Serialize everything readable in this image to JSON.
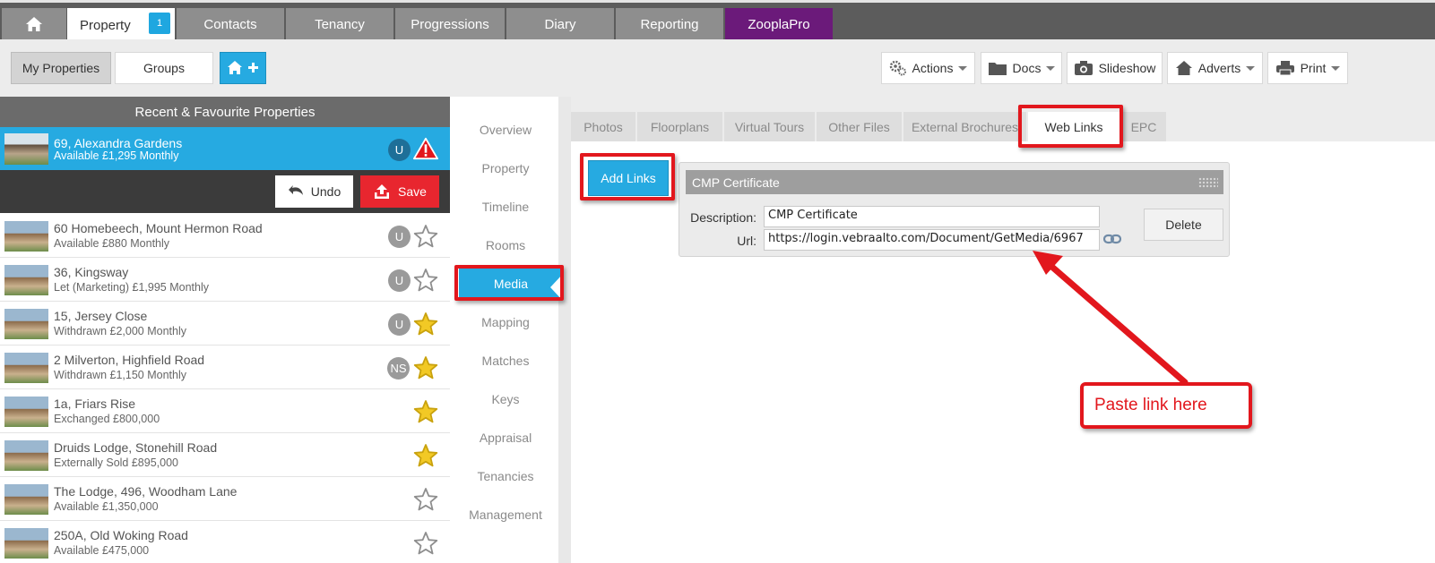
{
  "nav": {
    "tabs": [
      {
        "label": "Property",
        "badge": "1"
      },
      {
        "label": "Contacts"
      },
      {
        "label": "Tenancy"
      },
      {
        "label": "Progressions"
      },
      {
        "label": "Diary"
      },
      {
        "label": "Reporting"
      },
      {
        "label": "ZooplaPro"
      }
    ]
  },
  "toolbar": {
    "my_properties": "My Properties",
    "groups": "Groups",
    "actions": "Actions",
    "docs": "Docs",
    "slideshow": "Slideshow",
    "adverts": "Adverts",
    "print": "Print"
  },
  "recent": {
    "header": "Recent & Favourite Properties",
    "selected": {
      "address": "69, Alexandra Gardens",
      "status": "Available £1,295 Monthly",
      "badge": "U"
    },
    "undo": "Undo",
    "save": "Save",
    "items": [
      {
        "address": "60 Homebeech, Mount Hermon Road",
        "status": "Available £880 Monthly",
        "badge": "U",
        "favourite": false
      },
      {
        "address": "36, Kingsway",
        "status": "Let (Marketing) £1,995 Monthly",
        "badge": "U",
        "favourite": false
      },
      {
        "address": "15, Jersey Close",
        "status": "Withdrawn £2,000 Monthly",
        "badge": "U",
        "favourite": true
      },
      {
        "address": "2 Milverton, Highfield Road",
        "status": "Withdrawn £1,150 Monthly",
        "badge": "NS",
        "favourite": true
      },
      {
        "address": "1a, Friars Rise",
        "status": "Exchanged £800,000",
        "badge": "",
        "favourite": true
      },
      {
        "address": "Druids Lodge, Stonehill Road",
        "status": "Externally Sold £895,000",
        "badge": "",
        "favourite": true
      },
      {
        "address": "The Lodge, 496, Woodham Lane",
        "status": "Available £1,350,000",
        "badge": "",
        "favourite": false
      },
      {
        "address": "250A, Old Woking Road",
        "status": "Available £475,000",
        "badge": "",
        "favourite": false
      }
    ]
  },
  "menu": {
    "items": [
      "Overview",
      "Property",
      "Timeline",
      "Rooms",
      "Media",
      "Mapping",
      "Matches",
      "Keys",
      "Appraisal",
      "Tenancies",
      "Management"
    ],
    "active": "Media"
  },
  "media": {
    "tabs": [
      "Photos",
      "Floorplans",
      "Virtual Tours",
      "Other Files",
      "External Brochures",
      "Web Links",
      "EPC"
    ],
    "active_tab": "Web Links",
    "add_links": "Add Links",
    "link": {
      "title": "CMP Certificate",
      "description_label": "Description:",
      "description": "CMP Certificate",
      "url_label": "Url:",
      "url": "https://login.vebraalto.com/Document/GetMedia/6967",
      "delete": "Delete"
    }
  },
  "annotation": {
    "callout": "Paste link here"
  },
  "colors": {
    "accent": "#26aae1",
    "save": "#e8262f",
    "annotation": "#e2171d",
    "zoopla": "#6b1a7a"
  }
}
